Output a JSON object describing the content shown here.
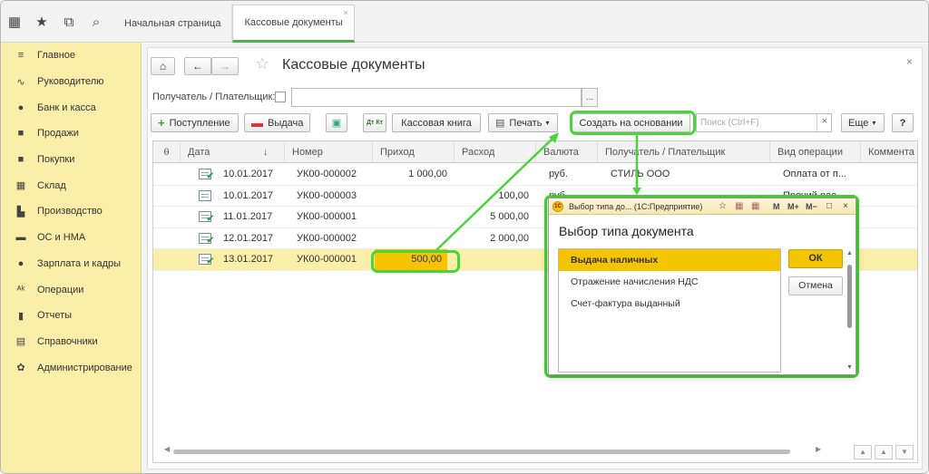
{
  "top_icons": [
    "grid-icon",
    "star-icon",
    "copy-icon",
    "search-icon"
  ],
  "tabs": [
    {
      "label": "Начальная страница"
    },
    {
      "label": "Кассовые документы",
      "close": "×"
    }
  ],
  "sidebar": {
    "items": [
      {
        "label": "Главное",
        "icon": "≡"
      },
      {
        "label": "Руководителю",
        "icon": "∿"
      },
      {
        "label": "Банк и касса",
        "icon": "●"
      },
      {
        "label": "Продажи",
        "icon": "■"
      },
      {
        "label": "Покупки",
        "icon": "■"
      },
      {
        "label": "Склад",
        "icon": "▦"
      },
      {
        "label": "Производство",
        "icon": "▙"
      },
      {
        "label": "ОС и НМА",
        "icon": "▬"
      },
      {
        "label": "Зарплата и кадры",
        "icon": "●"
      },
      {
        "label": "Операции",
        "icon": "ᴬᵏ"
      },
      {
        "label": "Отчеты",
        "icon": "▮"
      },
      {
        "label": "Справочники",
        "icon": "▤"
      },
      {
        "label": "Администрирование",
        "icon": "✿"
      }
    ]
  },
  "page": {
    "title": "Кассовые документы",
    "close": "×",
    "nav": {
      "home": "⌂",
      "back": "←",
      "forward": "→",
      "star": "☆"
    }
  },
  "filter": {
    "label": "Получатель / Плательщик:",
    "value": "",
    "dots": "..."
  },
  "toolbar": {
    "receipt": "Поступление",
    "issue": "Выдача",
    "cash_book": "Кассовая книга",
    "print": "Печать",
    "create_based": "Создать на основании",
    "search_placeholder": "Поиск (Ctrl+F)",
    "search_clear": "×",
    "more": "Еще",
    "help": "?",
    "at_icon": "Дт Кт",
    "dropdown": "▾"
  },
  "table": {
    "columns": [
      "",
      "Дата",
      "↓",
      "Номер",
      "Приход",
      "Расход",
      "Валюта",
      "Получатель / Плательщик",
      "Вид операции",
      "Коммента"
    ],
    "rows": [
      {
        "date": "10.01.2017",
        "number": "УК00-000002",
        "income": "1 000,00",
        "expense": "",
        "currency": "руб.",
        "counterparty": "СТИЛЬ ООО",
        "operation": "Оплата от п...",
        "posted": true
      },
      {
        "date": "10.01.2017",
        "number": "УК00-000003",
        "income": "",
        "expense": "100,00",
        "currency": "руб.",
        "counterparty": "",
        "operation": "Прочий рас...",
        "posted": false
      },
      {
        "date": "11.01.2017",
        "number": "УК00-000001",
        "income": "",
        "expense": "5 000,00",
        "currency": "",
        "counterparty": "",
        "operation": "",
        "posted": true
      },
      {
        "date": "12.01.2017",
        "number": "УК00-000002",
        "income": "",
        "expense": "2 000,00",
        "currency": "",
        "counterparty": "",
        "operation": "",
        "posted": true
      },
      {
        "date": "13.01.2017",
        "number": "УК00-000001",
        "income": "500,00",
        "expense": "",
        "currency": "",
        "counterparty": "",
        "operation": "",
        "posted": true,
        "selected": true
      }
    ]
  },
  "dialog": {
    "titlebar": "Выбор типа до...  (1С:Предприятие)",
    "logo": "1С",
    "title_icons": [
      "☆",
      "▦",
      "▦",
      "M",
      "M+",
      "M−",
      "□",
      "×"
    ],
    "heading": "Выбор типа документа",
    "items": [
      "Выдача наличных",
      "Отражение начисления НДС",
      "Счет-фактура выданный"
    ],
    "ok": "ОК",
    "cancel": "Отмена"
  },
  "colors": {
    "sidebar_bg": "#fbeea8",
    "selected_row": "#fbeea8",
    "highlight": "#4ad33a",
    "accent": "#f5c400"
  }
}
